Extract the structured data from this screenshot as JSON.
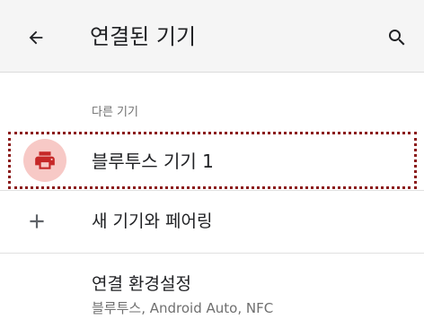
{
  "appbar": {
    "title": "연결된 기기",
    "back_icon": "arrow-back-icon",
    "search_icon": "search-icon"
  },
  "section": {
    "label": "다른 기기"
  },
  "device": {
    "name": "블루투스 기기 1",
    "icon": "printer-icon",
    "icon_color": "#c62828",
    "icon_bg": "#f7c9c6",
    "highlight_color": "#8b1a1a"
  },
  "pair": {
    "label": "새 기기와 페어링",
    "icon": "plus-icon"
  },
  "preferences": {
    "title": "연결 환경설정",
    "summary": "블루투스, Android Auto, NFC"
  }
}
